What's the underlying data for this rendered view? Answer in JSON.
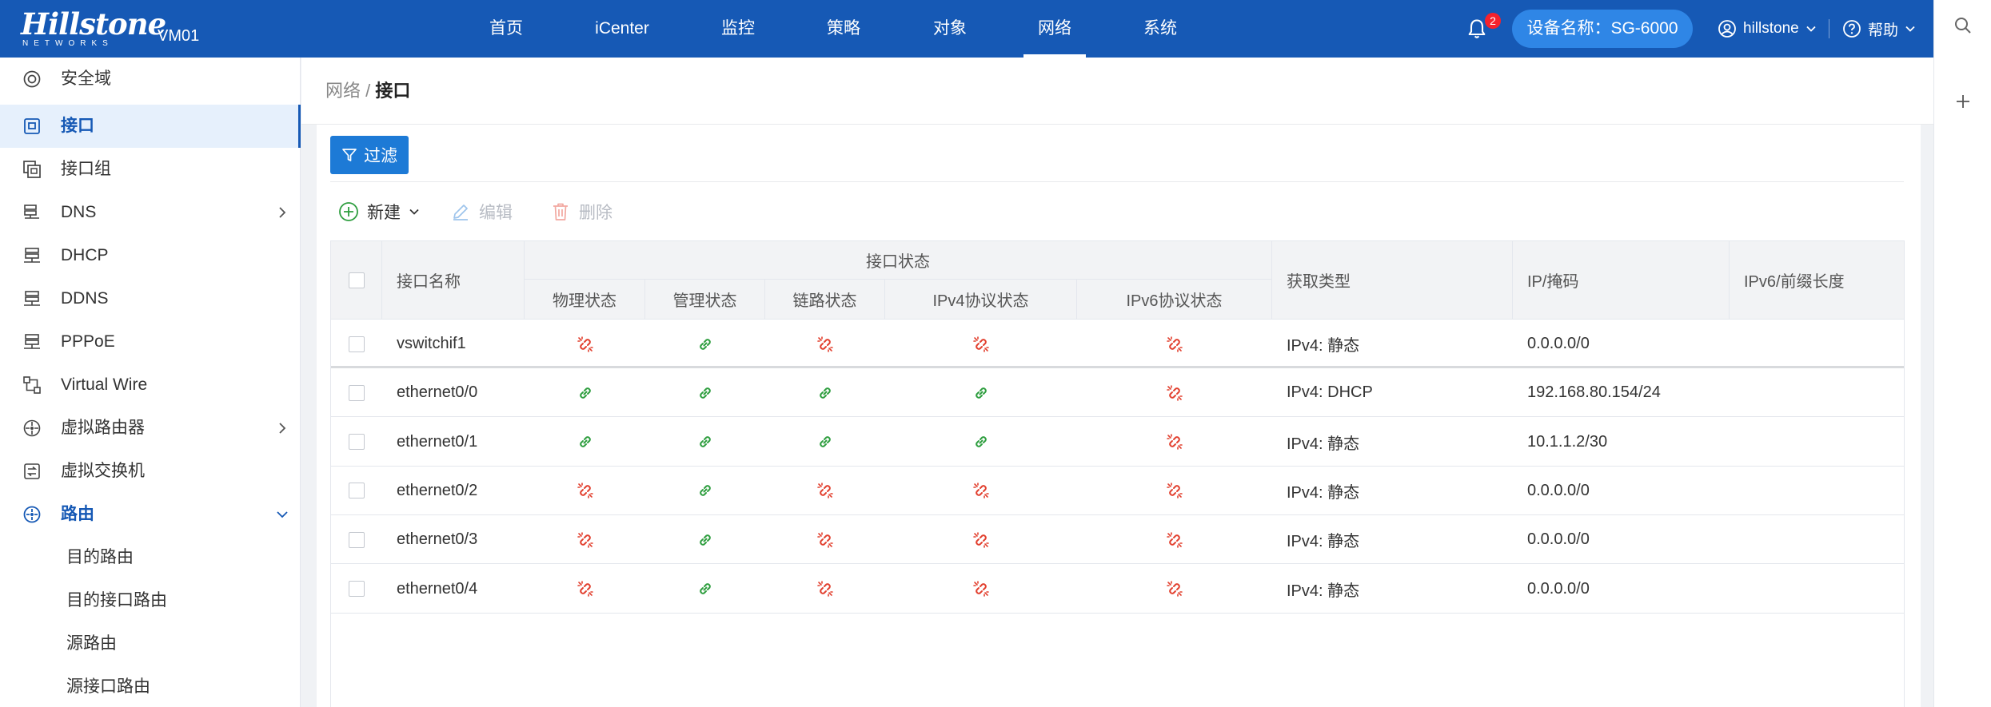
{
  "header": {
    "logo_main": "Hillstone",
    "logo_sub": "NETWORKS",
    "device_short": "VM01",
    "nav": [
      {
        "label": "首页",
        "active": false
      },
      {
        "label": "iCenter",
        "active": false
      },
      {
        "label": "监控",
        "active": false
      },
      {
        "label": "策略",
        "active": false
      },
      {
        "label": "对象",
        "active": false
      },
      {
        "label": "网络",
        "active": true
      },
      {
        "label": "系统",
        "active": false
      }
    ],
    "notification_count": "2",
    "device_name": "设备名称：SG-6000",
    "user": "hillstone",
    "help": "帮助"
  },
  "sidebar": {
    "items": [
      {
        "label": "安全域",
        "icon": "security-zone-icon"
      },
      {
        "label": "接口",
        "icon": "interface-icon",
        "active": true
      },
      {
        "label": "接口组",
        "icon": "interface-group-icon"
      },
      {
        "label": "DNS",
        "icon": "dns-icon",
        "arrow": "right"
      },
      {
        "label": "DHCP",
        "icon": "dhcp-icon"
      },
      {
        "label": "DDNS",
        "icon": "ddns-icon"
      },
      {
        "label": "PPPoE",
        "icon": "pppoe-icon"
      },
      {
        "label": "Virtual Wire",
        "icon": "virtual-wire-icon"
      },
      {
        "label": "虚拟路由器",
        "icon": "virtual-router-icon",
        "arrow": "right"
      },
      {
        "label": "虚拟交换机",
        "icon": "virtual-switch-icon"
      },
      {
        "label": "路由",
        "icon": "routing-icon",
        "arrow": "down",
        "open": true
      }
    ],
    "sub_items": [
      "目的路由",
      "目的接口路由",
      "源路由",
      "源接口路由"
    ]
  },
  "breadcrumb": {
    "parent": "网络 /",
    "current": "接口"
  },
  "toolbar": {
    "filter": "过滤",
    "new": "新建",
    "edit": "编辑",
    "delete": "删除"
  },
  "table": {
    "col_name": "接口名称",
    "group_status": "接口状态",
    "status_cols": [
      "物理状态",
      "管理状态",
      "链路状态",
      "IPv4协议状态",
      "IPv6协议状态"
    ],
    "col_type": "获取类型",
    "col_ip": "IP/掩码",
    "col_ipv6": "IPv6/前缀长度",
    "rows": [
      {
        "name": "vswitchif1",
        "status": [
          "down",
          "up",
          "down",
          "down",
          "down"
        ],
        "type": "IPv4: 静态",
        "ip": "0.0.0.0/0",
        "ipv6": ""
      },
      {
        "name": "ethernet0/0",
        "status": [
          "up",
          "up",
          "up",
          "up",
          "down"
        ],
        "type": "IPv4: DHCP",
        "ip": "192.168.80.154/24",
        "ipv6": ""
      },
      {
        "name": "ethernet0/1",
        "status": [
          "up",
          "up",
          "up",
          "up",
          "down"
        ],
        "type": "IPv4: 静态",
        "ip": "10.1.1.2/30",
        "ipv6": ""
      },
      {
        "name": "ethernet0/2",
        "status": [
          "down",
          "up",
          "down",
          "down",
          "down"
        ],
        "type": "IPv4: 静态",
        "ip": "0.0.0.0/0",
        "ipv6": ""
      },
      {
        "name": "ethernet0/3",
        "status": [
          "down",
          "up",
          "down",
          "down",
          "down"
        ],
        "type": "IPv4: 静态",
        "ip": "0.0.0.0/0",
        "ipv6": ""
      },
      {
        "name": "ethernet0/4",
        "status": [
          "down",
          "up",
          "down",
          "down",
          "down"
        ],
        "type": "IPv4: 静态",
        "ip": "0.0.0.0/0",
        "ipv6": ""
      }
    ]
  },
  "colors": {
    "primary": "#1659b5",
    "accent": "#1d7ad6",
    "up": "#2e9e3f",
    "down": "#e2402f",
    "disabled": "#b8bcc4"
  }
}
